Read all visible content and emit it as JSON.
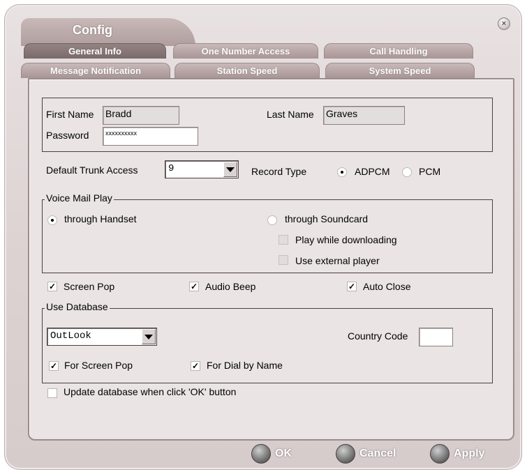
{
  "window": {
    "title": "Config",
    "close_label": "×"
  },
  "tabs": {
    "row1": [
      "General Info",
      "One Number Access",
      "Call Handling"
    ],
    "row2": [
      "Message Notification",
      "Station Speed",
      "System Speed"
    ]
  },
  "user": {
    "first_name_label": "First Name",
    "first_name_value": "Bradd",
    "last_name_label": "Last Name",
    "last_name_value": "Graves",
    "password_label": "Password",
    "password_value": "xxxxxxxxxx"
  },
  "trunk": {
    "label": "Default Trunk Access",
    "value": "9"
  },
  "record_type": {
    "label": "Record Type",
    "options": [
      "ADPCM",
      "PCM"
    ],
    "selected": "ADPCM"
  },
  "voice_mail": {
    "legend": "Voice Mail Play",
    "through_handset": "through Handset",
    "through_soundcard": "through Soundcard",
    "play_while_downloading": "Play while downloading",
    "use_external_player": "Use external player"
  },
  "options": {
    "screen_pop": "Screen Pop",
    "audio_beep": "Audio Beep",
    "auto_close": "Auto Close"
  },
  "database": {
    "legend": "Use Database",
    "selected": "OutLook",
    "country_code_label": "Country Code",
    "country_code_value": "",
    "for_screen_pop": "For Screen Pop",
    "for_dial_by_name": "For Dial by Name"
  },
  "update_db_label": "Update database when click 'OK' button",
  "buttons": {
    "ok": "OK",
    "cancel": "Cancel",
    "apply": "Apply"
  },
  "check_mark": "✓"
}
